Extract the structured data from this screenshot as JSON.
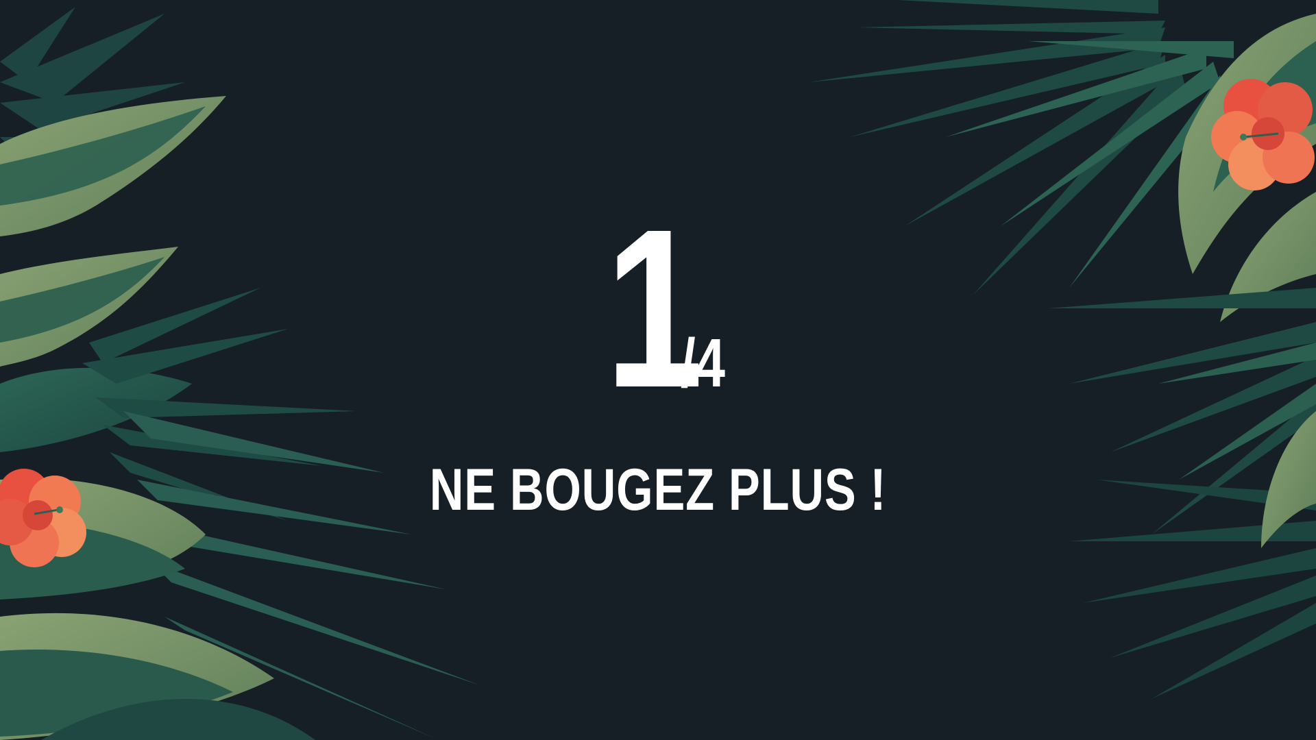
{
  "slide": {
    "counter_current": "1",
    "counter_total": "/4",
    "message": "NE BOUGEZ PLUS !"
  },
  "theme": {
    "background": "#161f26",
    "text": "#ffffff",
    "leaf_dark": "#1f4a44",
    "leaf_mid": "#2b5e4f",
    "leaf_light": "#7f9a6a",
    "flower": "#f06a4a"
  }
}
